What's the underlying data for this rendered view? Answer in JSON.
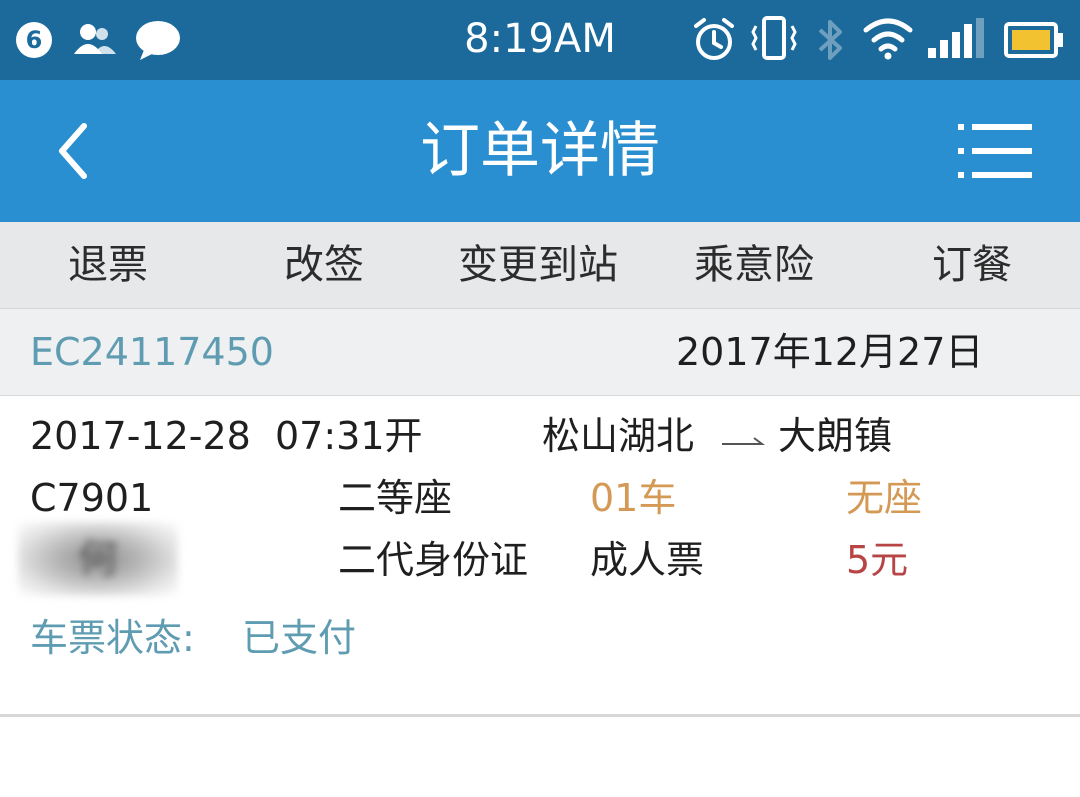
{
  "status_bar": {
    "notification_count": "6",
    "time": "8:19AM",
    "icons": [
      "contacts-icon",
      "chat-bubble-icon",
      "alarm-icon",
      "vibrate-icon",
      "bluetooth-icon",
      "wifi-icon",
      "signal-icon",
      "battery-icon"
    ]
  },
  "title_bar": {
    "title": "订单详情",
    "back_icon": "chevron-left-icon",
    "menu_icon": "menu-icon"
  },
  "actions": [
    "退票",
    "改签",
    "变更到站",
    "乘意险",
    "订餐"
  ],
  "order": {
    "order_number": "EC24117450",
    "order_date": "2017年12月27日"
  },
  "ticket": {
    "departure": "2017-12-28  07:31开",
    "from_station": "松山湖北",
    "to_station": "大朗镇",
    "train_no": "C7901",
    "seat_class": "二等座",
    "car": "01车",
    "seat": "无座",
    "passenger_name": "何",
    "id_type": "二代身份证",
    "ticket_type": "成人票",
    "price": "5元",
    "status_label": "车票状态:",
    "status_value": "已支付"
  },
  "colors": {
    "status_bar": "#1b6a9b",
    "title_bar": "#2a8fd0",
    "action_bar": "#e6e8ea",
    "accent_teal": "#5f9cb2",
    "accent_orange": "#d49a55",
    "accent_red": "#b74545"
  }
}
